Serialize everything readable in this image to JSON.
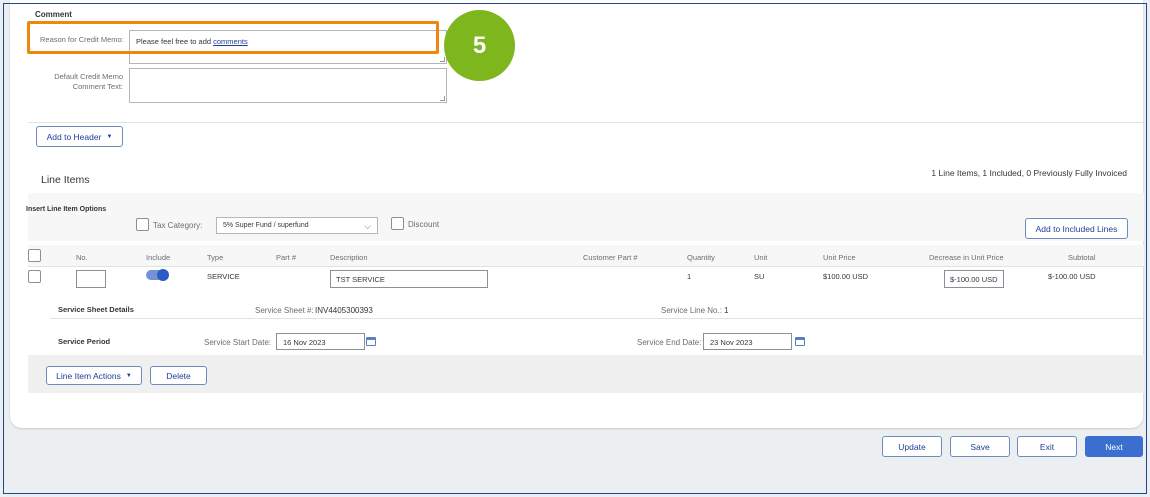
{
  "comment": {
    "section_title": "Comment",
    "reason_label": "Reason for Credit Memo:",
    "reason_value_prefix": "Please feel free to add ",
    "reason_value_link": "comments",
    "default_label": "Default Credit Memo Comment Text:",
    "default_value": ""
  },
  "callout": {
    "step": "5",
    "highlight_color": "#f0870a",
    "circle_color": "#7eb61e"
  },
  "header_buttons": {
    "add_to_header": "Add to Header",
    "add_to_header_icon": "caret-down-icon"
  },
  "line_items": {
    "title": "Line Items",
    "summary": "1 Line Items,  1 Included,  0 Previously Fully Invoiced",
    "options": {
      "title": "Insert Line Item Options",
      "tax_category_label": "Tax Category:",
      "tax_category_value": "5% Super Fund / superfund",
      "discount_label": "Discount",
      "add_to_included_lines": "Add to Included Lines"
    },
    "columns": [
      "No.",
      "Include",
      "Type",
      "Part #",
      "Description",
      "Customer Part #",
      "Quantity",
      "Unit",
      "Unit Price",
      "Decrease in Unit Price",
      "Subtotal"
    ],
    "row": {
      "no": "",
      "include": true,
      "type": "SERVICE",
      "part": "",
      "description": "TST SERVICE",
      "customer_part": "",
      "quantity": "1",
      "unit": "SU",
      "unit_price": "$100.00 USD",
      "decrease": "$-100.00 USD",
      "subtotal": "$-100.00 USD"
    },
    "service_sheet": {
      "title": "Service Sheet Details",
      "sheet_label": "Service Sheet #:",
      "sheet_value": "INV4405300393",
      "line_label": "Service Line No.:",
      "line_value": "1"
    },
    "service_period": {
      "title": "Service Period",
      "start_label": "Service Start Date:",
      "start_value": "16 Nov 2023",
      "end_label": "Service End Date:",
      "end_value": "23 Nov 2023"
    },
    "actions": {
      "line_item_actions": "Line Item Actions",
      "delete": "Delete"
    }
  },
  "footer": {
    "update": "Update",
    "save": "Save",
    "exit": "Exit",
    "next": "Next"
  }
}
